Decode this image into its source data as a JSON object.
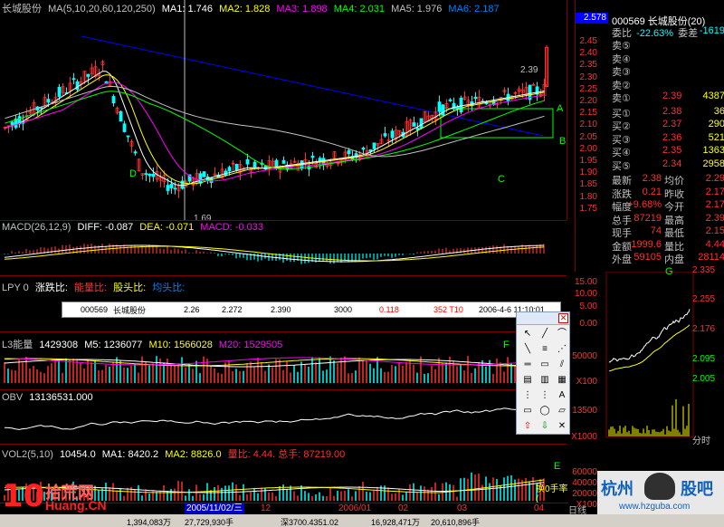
{
  "main": {
    "title": "长城股份",
    "ma_header": "MA(5,10,20,60,120,250)",
    "ma_values": [
      {
        "label": "MA1: 1.746",
        "color": "#ffffff"
      },
      {
        "label": "MA2: 1.828",
        "color": "#ffff00"
      },
      {
        "label": "MA3: 1.898",
        "color": "#ff00ff"
      },
      {
        "label": "MA4: 2.031",
        "color": "#00ff00"
      },
      {
        "label": "MA5: 1.976",
        "color": "#c0c0c0"
      },
      {
        "label": "MA6: 2.187",
        "color": "#0080ff"
      }
    ],
    "price_axis": [
      "2.50",
      "2.45",
      "2.40",
      "2.35",
      "2.30",
      "2.25",
      "2.20",
      "2.15",
      "2.10",
      "2.05",
      "2.00",
      "1.95",
      "1.90",
      "1.85",
      "1.80",
      "1.75"
    ],
    "high_label": "2.39",
    "low_label": "1.69",
    "current_price_box": "2.578",
    "annotations": {
      "A": "A",
      "B": "B",
      "C": "C",
      "D": "D"
    }
  },
  "macd": {
    "title": "MACD(26,12,9)",
    "diff": "DIFF: -0.087",
    "dea": "DEA: -0.071",
    "macd": "MACD: -0.033",
    "axis": [
      "0.10",
      "0.05",
      "0.00",
      "-0.05"
    ]
  },
  "lpy": {
    "title": "LPY  0",
    "items": [
      "涨跌比:",
      "能量比:",
      "股头比:",
      "均头比:"
    ],
    "axis": [
      "15.00",
      "10.00",
      "5.00",
      "0.00"
    ]
  },
  "tooltip": {
    "cells": [
      "000569",
      "长城股份",
      "2.26",
      "2.272",
      "2.390",
      "3000",
      "0.118",
      "352  T10",
      "2006-4-6  11:10:01"
    ]
  },
  "l3": {
    "title": "L3能量",
    "value": "1429308",
    "m5": "M5: 1236077",
    "m10": "M10: 1566028",
    "m20": "M20: 1529505",
    "axis": [
      "50000",
      "X100"
    ],
    "annotation": "F"
  },
  "obv": {
    "title": "OBV",
    "value": "13136531.000",
    "axis": [
      "13500",
      "X1000"
    ]
  },
  "vol": {
    "title": "VOL2(5,10)",
    "value": "10454.0",
    "ma1": "MA1: 8420.2",
    "ma2": "MA2: 8826.0",
    "extra": "量比: 4.44. 总手: 87219.00",
    "axis": [
      "60000",
      "40000",
      "20000",
      "X100"
    ],
    "annotation": "E",
    "hint": "换0手率("
  },
  "timeline": {
    "date_tag": "2005/11/02/三",
    "labels": [
      "12",
      "2006/01",
      "02",
      "03",
      "04"
    ],
    "period": "日线"
  },
  "status_bar": {
    "items": [
      "1,394,083万",
      "27,729,930手",
      "深3700.4351.02",
      "16,928,471万",
      "20,610,896手"
    ]
  },
  "quote": {
    "header": "000569 长城股份(20)",
    "weibi": "委比",
    "weibi_val": "-22.63%",
    "weicha": "委差",
    "weicha_val": "-1619",
    "sell": [
      {
        "label": "卖⑤",
        "price": "",
        "vol": ""
      },
      {
        "label": "卖④",
        "price": "",
        "vol": ""
      },
      {
        "label": "卖③",
        "price": "",
        "vol": ""
      },
      {
        "label": "卖②",
        "price": "",
        "vol": ""
      },
      {
        "label": "卖①",
        "price": "2.39",
        "vol": "4387"
      }
    ],
    "buy": [
      {
        "label": "买①",
        "price": "2.38",
        "vol": "36"
      },
      {
        "label": "买②",
        "price": "2.37",
        "vol": "290"
      },
      {
        "label": "买③",
        "price": "2.36",
        "vol": "521"
      },
      {
        "label": "买④",
        "price": "2.35",
        "vol": "1363"
      },
      {
        "label": "买⑤",
        "price": "2.34",
        "vol": "2958"
      }
    ],
    "stats": [
      {
        "l1": "最新",
        "v1": "2.38",
        "l2": "均价",
        "v2": "2.29"
      },
      {
        "l1": "涨跌",
        "v1": "0.21",
        "l2": "昨收",
        "v2": "2.17"
      },
      {
        "l1": "幅度",
        "v1": "+9.68%",
        "l2": "今开",
        "v2": "2.17"
      },
      {
        "l1": "总手",
        "v1": "87219",
        "l2": "最高",
        "v2": "2.39"
      },
      {
        "l1": "现手",
        "v1": "74",
        "l2": "最低",
        "v2": "2.15"
      },
      {
        "l1": "金额",
        "v1": "1999.6",
        "l2": "量比",
        "v2": "4.44"
      },
      {
        "l1": "外盘",
        "v1": "59105",
        "l2": "内盘",
        "v2": "28114"
      }
    ],
    "intraday_axis": [
      "2.335",
      "2.255",
      "2.176",
      "2.095",
      "2.005"
    ],
    "intraday_label": "G",
    "time_label": "分时"
  },
  "watermarks": {
    "left_num": "10",
    "left_cn": "拾荒网",
    "left_url": "Huang.CN",
    "right_cn1": "杭州",
    "right_cn2": "股吧",
    "right_url": "www.hzguba.com"
  },
  "toolbox": {
    "items": [
      "↖",
      "╱",
      "⌒",
      "╲",
      "≡",
      "⋰",
      "═",
      "▭",
      "⫽",
      "▤",
      "▥",
      "▦",
      "⋮",
      "⋮",
      "A",
      "▭",
      "◯",
      "▱",
      "⇧",
      "⇩",
      "✕"
    ]
  },
  "colors": {
    "up": "#ff3030",
    "down": "#00ffff",
    "ma1": "#ffffff",
    "ma2": "#ffff00",
    "ma3": "#ff00ff",
    "ma4": "#00ff00",
    "ma6": "#0000ff"
  }
}
